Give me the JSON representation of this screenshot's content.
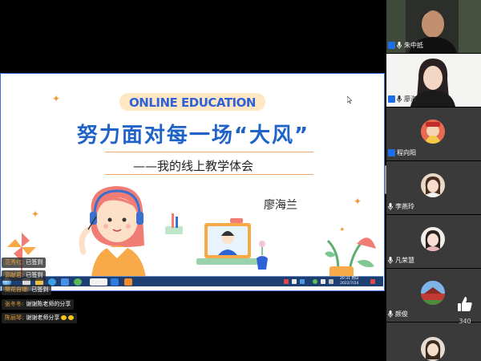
{
  "slide": {
    "banner": "ONLINE EDUCATION",
    "title": "努力面对每一场“大风”",
    "subtitle": "——我的线上教学体会",
    "presenter": "廖海兰"
  },
  "taskbar": {
    "clock_time": "20:31 周日",
    "clock_date": "2022/7/24"
  },
  "chat": {
    "messages": [
      {
        "name": "范秀红:",
        "text": "已签到"
      },
      {
        "name": "郭献君:",
        "text": "已签到"
      },
      {
        "name": "樊花自铺:",
        "text": "已签到"
      },
      {
        "name": "张冬冬:",
        "text": "谢谢陈老师的分享"
      },
      {
        "name": "陈丽琴:",
        "text": "谢谢老师分享"
      }
    ]
  },
  "participants": [
    {
      "name": "朱中抵",
      "mic": true
    },
    {
      "name": "廖海兰",
      "mic": true
    },
    {
      "name": "程向阳",
      "mic": false
    },
    {
      "name": "李燕玲",
      "mic": false
    },
    {
      "name": "凡荣慧",
      "mic": false
    },
    {
      "name": "颜俊",
      "mic": false
    },
    {
      "name": "",
      "mic": false
    }
  ],
  "likes": {
    "count": "340",
    "icon": "thumbs-up-icon"
  },
  "colors": {
    "title_blue": "#1f63c8",
    "banner_orange": "#ffe7c4",
    "accent_orange": "#f39a3c",
    "user_icon_blue": "#1e6ee8"
  }
}
